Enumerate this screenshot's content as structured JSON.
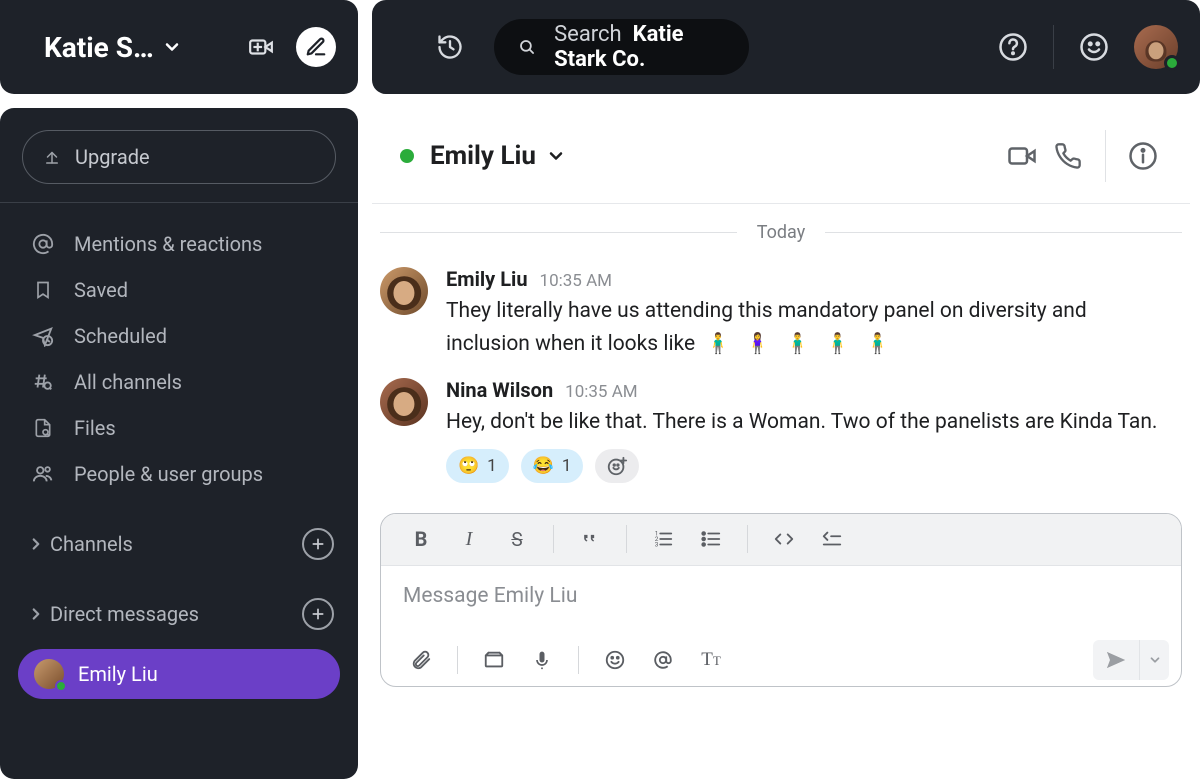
{
  "workspace": {
    "name": "Katie S…"
  },
  "search": {
    "label": "Search",
    "bold": "Katie Stark Co."
  },
  "sidebar": {
    "upgrade": "Upgrade",
    "nav": {
      "mentions": "Mentions & reactions",
      "saved": "Saved",
      "scheduled": "Scheduled",
      "all_channels": "All channels",
      "files": "Files",
      "people": "People & user groups"
    },
    "sections": {
      "channels": "Channels",
      "dms": "Direct messages"
    },
    "dm": {
      "emily": "Emily Liu"
    }
  },
  "channel": {
    "name": "Emily Liu"
  },
  "divider_label": "Today",
  "messages": [
    {
      "author": "Emily Liu",
      "time": "10:35 AM",
      "text_pre": "They literally have us attending this mandatory panel on diversity and inclusion when it looks like ",
      "emojis": "🧍‍♂️ 🧍‍♀️ 🧍‍♂️ 🧍‍♂️ 🧍‍♂️"
    },
    {
      "author": "Nina Wilson",
      "time": "10:35 AM",
      "text": "Hey, don't be like that. There is a Woman. Two of the panelists are Kinda Tan.",
      "reactions": [
        {
          "emoji": "🙄",
          "count": "1"
        },
        {
          "emoji": "😂",
          "count": "1"
        }
      ]
    }
  ],
  "composer": {
    "placeholder": "Message Emily Liu"
  }
}
